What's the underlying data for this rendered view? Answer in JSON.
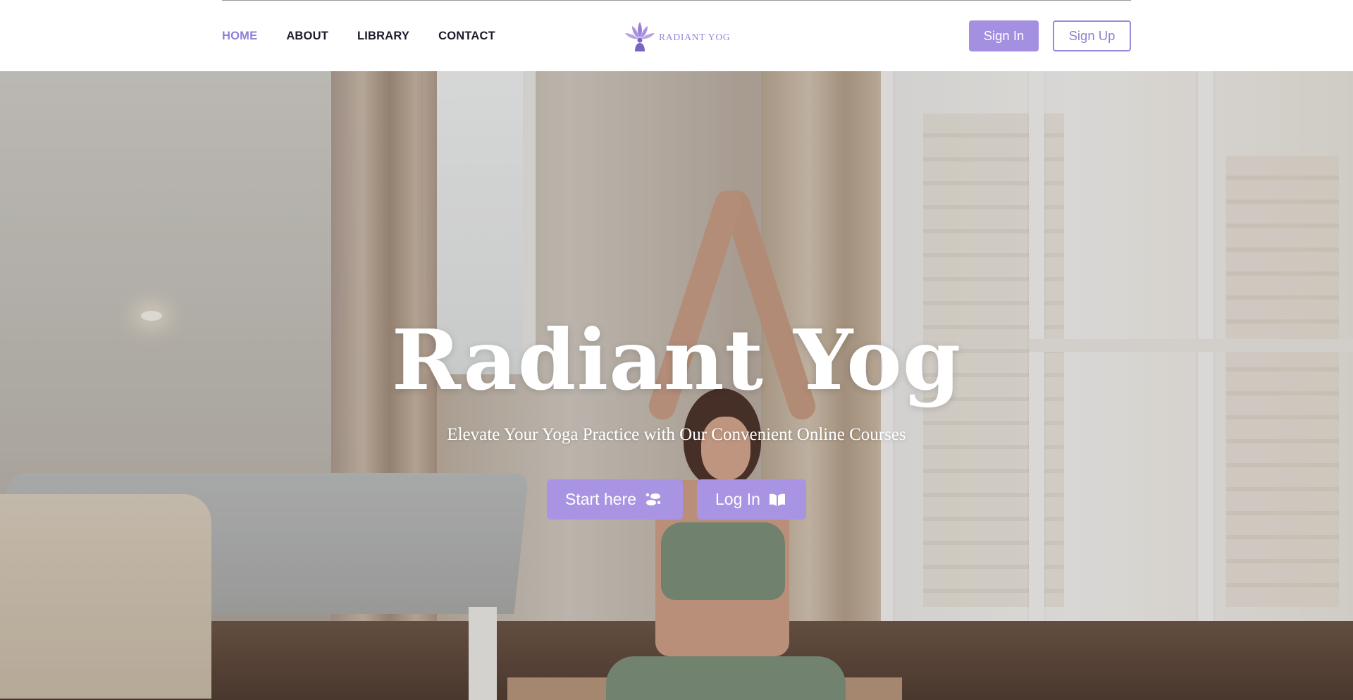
{
  "nav": {
    "items": [
      {
        "label": "HOME",
        "active": true
      },
      {
        "label": "ABOUT",
        "active": false
      },
      {
        "label": "LIBRARY",
        "active": false
      },
      {
        "label": "CONTACT",
        "active": false
      }
    ]
  },
  "logo": {
    "text": "RADIANT YOG",
    "icon": "lotus-meditation-icon"
  },
  "auth": {
    "signin_label": "Sign In",
    "signup_label": "Sign Up"
  },
  "hero": {
    "title": "Radiant Yog",
    "subtitle": "Elevate Your Yoga Practice with Our Convenient Online Courses",
    "start_label": "Start here",
    "start_icon": "footprints-icon",
    "login_label": "Log In",
    "login_icon": "open-book-icon"
  },
  "colors": {
    "accent": "#a48fe0",
    "nav_active": "#8f81d6",
    "nav_text": "#1b1b2a"
  }
}
